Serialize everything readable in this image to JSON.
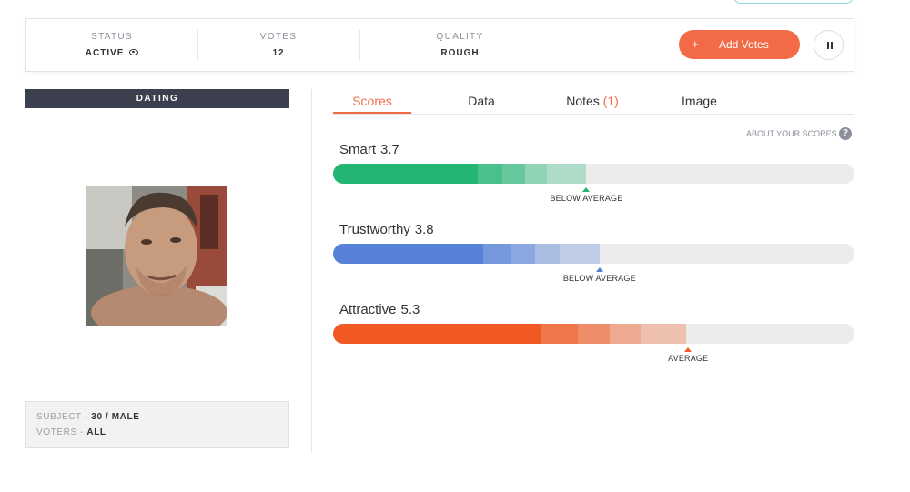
{
  "stats": {
    "status": {
      "label": "STATUS",
      "value": "ACTIVE"
    },
    "votes": {
      "label": "VOTES",
      "value": "12"
    },
    "quality": {
      "label": "QUALITY",
      "value": "ROUGH"
    }
  },
  "actions": {
    "add_votes_plus": "+",
    "add_votes_label": "Add Votes"
  },
  "category": "DATING",
  "subject": {
    "label": "SUBJECT - ",
    "value": "30 / MALE"
  },
  "voters": {
    "label": "VOTERS - ",
    "value": "ALL"
  },
  "tabs": [
    {
      "label": "Scores",
      "active": true
    },
    {
      "label": "Data"
    },
    {
      "label": "Notes",
      "count": "(1)"
    },
    {
      "label": "Image"
    }
  ],
  "about_scores": "ABOUT YOUR SCORES",
  "about_icon": "?",
  "scores": [
    {
      "name": "Smart",
      "value": "3.7",
      "rating": "BELOW AVERAGE",
      "color": "#22b573",
      "fill_pct": 0.486
    },
    {
      "name": "Trustworthy",
      "value": "3.8",
      "rating": "BELOW AVERAGE",
      "color": "#5882d8",
      "fill_pct": 0.511
    },
    {
      "name": "Attractive",
      "value": "5.3",
      "rating": "AVERAGE",
      "color": "#f05a22",
      "fill_pct": 0.681
    }
  ]
}
